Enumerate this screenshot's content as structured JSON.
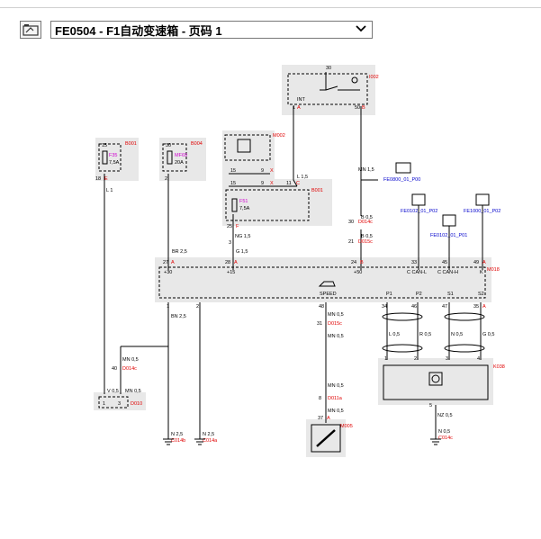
{
  "toolbar": {
    "title": "FE0504 - F1自动变速箱 - 页码 1"
  },
  "diagram": {
    "i002": {
      "id": "I002",
      "pin_top": "30",
      "label": "INT",
      "pin1": "1",
      "pin1_letter": "A",
      "pin50": "50",
      "pin50_letter": "B"
    },
    "b001a": {
      "id": "B001",
      "fuse": "F35",
      "rating": "7,5A",
      "pin_top": "15",
      "pin_bottom": "18",
      "pin_bottom_letter": "E"
    },
    "b004": {
      "id": "B004",
      "fuse": "MF69",
      "rating": "20A",
      "pin_top": "30",
      "pin_bottom": "2"
    },
    "m002": {
      "id": "M002",
      "r1_a": "15",
      "r1_b": "9",
      "r1_x": "X",
      "r2_a": "15",
      "r2_b": "9",
      "r2_x": "X"
    },
    "b001b": {
      "id": "B001",
      "fuse": "F51",
      "rating": "7,5A",
      "pin_top": "11",
      "pin_top_letter": "C",
      "pin_bottom": "25",
      "pin_bottom_letter": "F"
    },
    "wires": {
      "l1": "L 1",
      "l15": "L 1,5",
      "mn15": "MN 1,5",
      "b05a": "B 0,5",
      "b05b": "B 0,5",
      "ng15": "NG 1,5",
      "br25": "BR 2,5",
      "g15": "G 1,5",
      "bn25": "BN 2,5",
      "mn05a": "MN 0,5",
      "mn05b": "MN 0,5",
      "mn05c": "MN 0,5",
      "mn05d": "MN 0,5",
      "mn05e": "MN 0,5",
      "v05": "V 0,5",
      "n25a": "N 2,5",
      "n25b": "N 2,5",
      "l05": "L 0,5",
      "r05": "R 0,5",
      "n05": "N 0,5",
      "g05": "G 0,5",
      "nz05": "NZ 0,5",
      "n05b": "N 0,5"
    },
    "conn": {
      "d014c_top": "D014c",
      "d014c_top_pin": "30",
      "d015c_top": "D015c",
      "d015c_top_pin": "21",
      "d014c_left": "D014c",
      "d014c_left_pin": "40",
      "d015c_mid": "D015c",
      "d015c_mid_pin": "31",
      "d011a": "D011a",
      "d011a_pin": "8",
      "pin3_left": "3"
    },
    "refs": {
      "fe0800": "FE0800_01_P00",
      "fe0102a": "FE0102_01_P02",
      "fe0102b": "FE0102_01_P01",
      "fe1000": "FE1000_01_P02"
    },
    "m018": {
      "id": "M018",
      "p27": "27",
      "p27l": "A",
      "p28": "28",
      "p28l": "A",
      "p24": "24",
      "p24l": "B",
      "p33": "33",
      "p45": "45",
      "p49": "49",
      "p49l": "A",
      "lbl_30": "+30",
      "lbl_15": "+15",
      "lbl_50": "+50",
      "lbl_canl": "C CAN-L",
      "lbl_canh": "C CAN-H",
      "lbl_k": "K",
      "lbl_speed": "SPEED",
      "lbl_p1": "P1",
      "lbl_p2": "P2",
      "lbl_s1": "S1",
      "lbl_s2": "S2",
      "b1": "1",
      "b2": "2",
      "b48": "48",
      "b34": "34",
      "b46": "46",
      "b47": "47",
      "b35": "35",
      "b35l": "A"
    },
    "d010": {
      "id": "D010",
      "p1": "1",
      "p3": "3"
    },
    "k038": {
      "id": "K038",
      "p1": "1",
      "p2": "2",
      "p3": "3",
      "p4": "4",
      "p5": "5"
    },
    "m005": {
      "id": "M005",
      "pin": "37",
      "pin_letter": "A"
    },
    "grounds": {
      "g1": "C014b",
      "g2": "C014a",
      "g3": "C014c"
    }
  },
  "colors": {
    "red": "#e00000",
    "blue": "#0000cc",
    "magenta": "#d000d0",
    "grey_box": "#e9e9e9"
  }
}
